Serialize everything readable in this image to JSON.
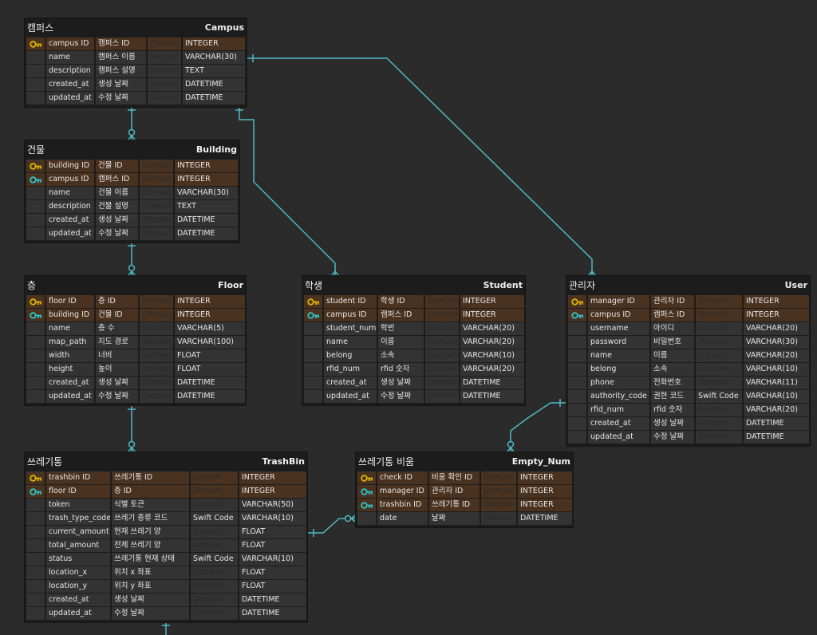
{
  "colors": {
    "link": "#4fb8c4",
    "pk_key": "#e0b400",
    "fk_key": "#2ec4c8",
    "pk_row": "#4a3220"
  },
  "domain_placeholder": "Domain",
  "entities": [
    {
      "id": "campus",
      "logical": "캠퍼스",
      "physical": "Campus",
      "columns": [
        {
          "key": "pk",
          "name": "campus ID",
          "logical": "캠퍼스 ID",
          "domain": "",
          "type": "INTEGER"
        },
        {
          "key": "",
          "name": "name",
          "logical": "캠퍼스 이름",
          "domain": "",
          "type": "VARCHAR(30)"
        },
        {
          "key": "",
          "name": "description",
          "logical": "캠퍼스 설명",
          "domain": "",
          "type": "TEXT"
        },
        {
          "key": "",
          "name": "created_at",
          "logical": "생성 날짜",
          "domain": "",
          "type": "DATETIME"
        },
        {
          "key": "",
          "name": "updated_at",
          "logical": "수정 날짜",
          "domain": "",
          "type": "DATETIME"
        }
      ]
    },
    {
      "id": "building",
      "logical": "건물",
      "physical": "Building",
      "columns": [
        {
          "key": "pk",
          "name": "building ID",
          "logical": "건물 ID",
          "domain": "",
          "type": "INTEGER"
        },
        {
          "key": "fk",
          "name": "campus ID",
          "logical": "캠퍼스 ID",
          "domain": "",
          "type": "INTEGER"
        },
        {
          "key": "",
          "name": "name",
          "logical": "건물 이름",
          "domain": "",
          "type": "VARCHAR(30)"
        },
        {
          "key": "",
          "name": "description",
          "logical": "건물 설명",
          "domain": "",
          "type": "TEXT"
        },
        {
          "key": "",
          "name": "created_at",
          "logical": "생성 날짜",
          "domain": "",
          "type": "DATETIME"
        },
        {
          "key": "",
          "name": "updated_at",
          "logical": "수정 날짜",
          "domain": "",
          "type": "DATETIME"
        }
      ]
    },
    {
      "id": "floor",
      "logical": "층",
      "physical": "Floor",
      "columns": [
        {
          "key": "pk",
          "name": "floor ID",
          "logical": "층 ID",
          "domain": "",
          "type": "INTEGER"
        },
        {
          "key": "fk",
          "name": "building ID",
          "logical": "건물 ID",
          "domain": "",
          "type": "INTEGER"
        },
        {
          "key": "",
          "name": "name",
          "logical": "층 수",
          "domain": "",
          "type": "VARCHAR(5)"
        },
        {
          "key": "",
          "name": "map_path",
          "logical": "지도 경로",
          "domain": "",
          "type": "VARCHAR(100)"
        },
        {
          "key": "",
          "name": "width",
          "logical": "너비",
          "domain": "",
          "type": "FLOAT"
        },
        {
          "key": "",
          "name": "height",
          "logical": "높이",
          "domain": "",
          "type": "FLOAT"
        },
        {
          "key": "",
          "name": "created_at",
          "logical": "생성 날짜",
          "domain": "",
          "type": "DATETIME"
        },
        {
          "key": "",
          "name": "updated_at",
          "logical": "수정 날짜",
          "domain": "",
          "type": "DATETIME"
        }
      ]
    },
    {
      "id": "student",
      "logical": "학생",
      "physical": "Student",
      "columns": [
        {
          "key": "pk",
          "name": "student ID",
          "logical": "학생 ID",
          "domain": "",
          "type": "INTEGER"
        },
        {
          "key": "fk",
          "name": "campus ID",
          "logical": "캠퍼스 ID",
          "domain": "",
          "type": "INTEGER"
        },
        {
          "key": "",
          "name": "student_num",
          "logical": "학번",
          "domain": "",
          "type": "VARCHAR(20)"
        },
        {
          "key": "",
          "name": "name",
          "logical": "이름",
          "domain": "",
          "type": "VARCHAR(20)"
        },
        {
          "key": "",
          "name": "belong",
          "logical": "소속",
          "domain": "",
          "type": "VARCHAR(10)"
        },
        {
          "key": "",
          "name": "rfid_num",
          "logical": "rfid 숫자",
          "domain": "",
          "type": "VARCHAR(20)"
        },
        {
          "key": "",
          "name": "created_at",
          "logical": "생성 날짜",
          "domain": "",
          "type": "DATETIME"
        },
        {
          "key": "",
          "name": "updated_at",
          "logical": "수정 날짜",
          "domain": "",
          "type": "DATETIME"
        }
      ]
    },
    {
      "id": "user",
      "logical": "관리자",
      "physical": "User",
      "columns": [
        {
          "key": "pk",
          "name": "manager ID",
          "logical": "관리자 ID",
          "domain": "",
          "type": "INTEGER"
        },
        {
          "key": "fk",
          "name": "campus ID",
          "logical": "캠퍼스 ID",
          "domain": "",
          "type": "INTEGER"
        },
        {
          "key": "",
          "name": "username",
          "logical": "아이디",
          "domain": "",
          "type": "VARCHAR(20)"
        },
        {
          "key": "",
          "name": "password",
          "logical": "비밀번호",
          "domain": "",
          "type": "VARCHAR(30)"
        },
        {
          "key": "",
          "name": "name",
          "logical": "이름",
          "domain": "",
          "type": "VARCHAR(20)"
        },
        {
          "key": "",
          "name": "belong",
          "logical": "소속",
          "domain": "",
          "type": "VARCHAR(10)"
        },
        {
          "key": "",
          "name": "phone",
          "logical": "전화번호",
          "domain": "",
          "type": "VARCHAR(11)"
        },
        {
          "key": "",
          "name": "authority_code",
          "logical": "권한 코드",
          "domain": "Swift Code",
          "type": "VARCHAR(10)"
        },
        {
          "key": "",
          "name": "rfid_num",
          "logical": "rfid 숫자",
          "domain": "",
          "type": "VARCHAR(20)"
        },
        {
          "key": "",
          "name": "created_at",
          "logical": "생성 날짜",
          "domain": "",
          "type": "DATETIME"
        },
        {
          "key": "",
          "name": "updated_at",
          "logical": "수정 날짜",
          "domain": "",
          "type": "DATETIME"
        }
      ]
    },
    {
      "id": "trashbin",
      "logical": "쓰레기통",
      "physical": "TrashBin",
      "columns": [
        {
          "key": "pk",
          "name": "trashbin ID",
          "logical": "쓰레기통 ID",
          "domain": "",
          "type": "INTEGER"
        },
        {
          "key": "fk",
          "name": "floor ID",
          "logical": "층 ID",
          "domain": "",
          "type": "INTEGER"
        },
        {
          "key": "",
          "name": "token",
          "logical": "식별 토큰",
          "domain": "",
          "type": "VARCHAR(50)"
        },
        {
          "key": "",
          "name": "trash_type_code",
          "logical": "쓰레기 종류 코드",
          "domain": "Swift Code",
          "type": "VARCHAR(10)"
        },
        {
          "key": "",
          "name": "current_amount",
          "logical": "현재 쓰레기 양",
          "domain": "",
          "type": "FLOAT"
        },
        {
          "key": "",
          "name": "total_amount",
          "logical": "전체 쓰레기 양",
          "domain": "",
          "type": "FLOAT"
        },
        {
          "key": "",
          "name": "status",
          "logical": "쓰레기통 현재 상태",
          "domain": "Swift Code",
          "type": "VARCHAR(10)"
        },
        {
          "key": "",
          "name": "location_x",
          "logical": "위치 x 좌표",
          "domain": "",
          "type": "FLOAT"
        },
        {
          "key": "",
          "name": "location_y",
          "logical": "위치 y 좌표",
          "domain": "",
          "type": "FLOAT"
        },
        {
          "key": "",
          "name": "created_at",
          "logical": "생성 날짜",
          "domain": "",
          "type": "DATETIME"
        },
        {
          "key": "",
          "name": "updated_at",
          "logical": "수정 날짜",
          "domain": "",
          "type": "DATETIME"
        }
      ]
    },
    {
      "id": "empty_num",
      "logical": "쓰레기통 비움",
      "physical": "Empty_Num",
      "columns": [
        {
          "key": "pk",
          "name": "check ID",
          "logical": "비움 확인 ID",
          "domain": "",
          "type": "INTEGER"
        },
        {
          "key": "fk",
          "name": "manager ID",
          "logical": "관리자 ID",
          "domain": "",
          "type": "INTEGER"
        },
        {
          "key": "fk",
          "name": "trashbin ID",
          "logical": "쓰레기통 ID",
          "domain": "",
          "type": "INTEGER"
        },
        {
          "key": "",
          "name": "date",
          "logical": "날짜",
          "domain": "",
          "type": "DATETIME"
        }
      ]
    }
  ]
}
